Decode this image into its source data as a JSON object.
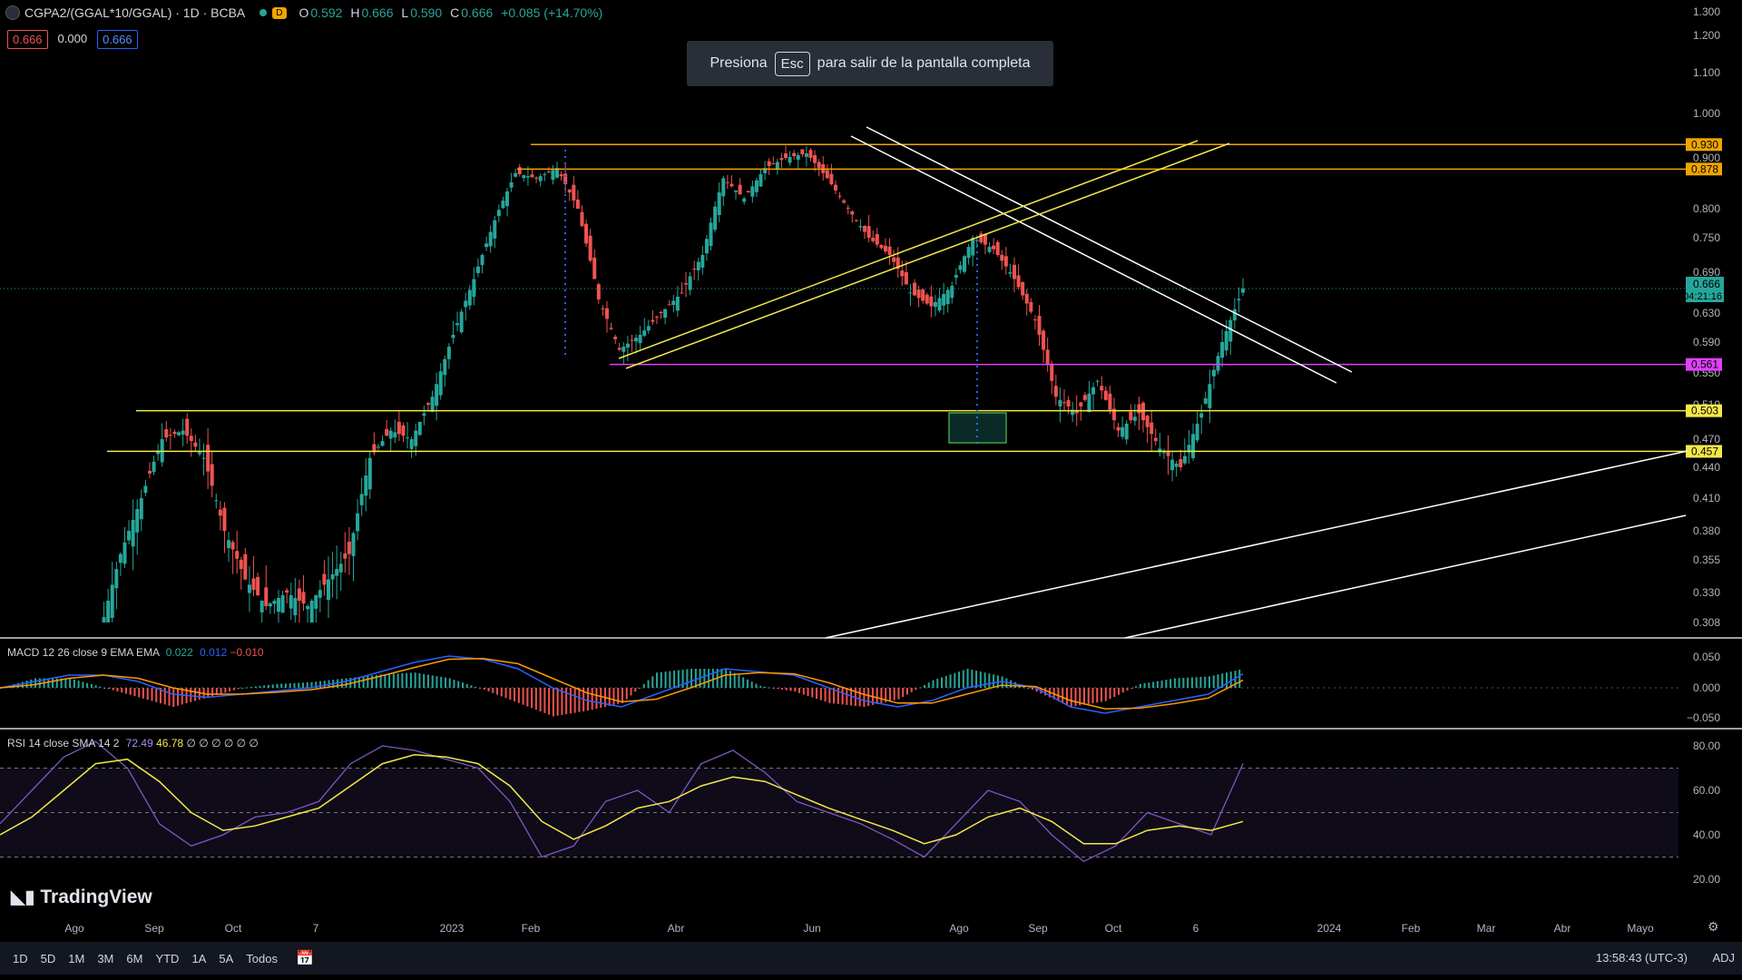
{
  "header": {
    "symbol": "CGPA2/(GGAL*10/GGAL) · 1D · BCBA",
    "d_badge": "D",
    "o_label": "O",
    "o": "0.592",
    "h_label": "H",
    "h": "0.666",
    "l_label": "L",
    "l": "0.590",
    "c_label": "C",
    "c": "0.666",
    "change": "+0.085 (+14.70%)"
  },
  "badges": [
    "0.666",
    "0.000",
    "0.666"
  ],
  "toast": {
    "before": "Presiona",
    "key": "Esc",
    "after": "para salir de la pantalla completa"
  },
  "macd_label": {
    "name": "MACD 12 26 close 9 EMA EMA",
    "v1": "0.022",
    "v2": "0.012",
    "v3": "−0.010"
  },
  "rsi_label": {
    "name": "RSI 14 close SMA 14 2",
    "v1": "72.49",
    "v2": "46.78",
    "rest": "∅ ∅ ∅ ∅ ∅ ∅"
  },
  "logo": "TradingView",
  "timeframes": [
    "1D",
    "5D",
    "1M",
    "3M",
    "6M",
    "YTD",
    "1A",
    "5A",
    "Todos"
  ],
  "clock": "13:58:43 (UTC-3)",
  "adj": "ADJ",
  "colors": {
    "up": "#26a69a",
    "down": "#ef5350",
    "orange": "#f0a500",
    "yellow": "#f5e84a",
    "magenta": "#e040fb",
    "macd": "#2962ff",
    "signal": "#ff9800",
    "rsi": "#7e57c2"
  },
  "chart_data": [
    {
      "type": "candlestick",
      "title": "CGPA2/(GGAL*10/GGAL) · 1D · BCBA",
      "x_ticks": [
        "Ago",
        "Sep",
        "Oct",
        "7",
        "2023",
        "Feb",
        "Abr",
        "Jun",
        "Ago",
        "Sep",
        "Oct",
        "6",
        "2024",
        "Feb",
        "Mar",
        "Abr",
        "Mayo"
      ],
      "y_ticks": [
        "1.300",
        "1.200",
        "1.100",
        "1.000",
        "0.900",
        "0.800",
        "0.750",
        "0.690",
        "0.630",
        "0.590",
        "0.550",
        "0.510",
        "0.470",
        "0.440",
        "0.410",
        "0.380",
        "0.355",
        "0.330",
        "0.308"
      ],
      "closes_approx": [
        0.3,
        0.36,
        0.41,
        0.47,
        0.48,
        0.45,
        0.38,
        0.34,
        0.32,
        0.33,
        0.32,
        0.34,
        0.36,
        0.45,
        0.48,
        0.47,
        0.52,
        0.6,
        0.68,
        0.78,
        0.87,
        0.86,
        0.88,
        0.8,
        0.65,
        0.58,
        0.6,
        0.63,
        0.66,
        0.72,
        0.86,
        0.82,
        0.88,
        0.9,
        0.91,
        0.86,
        0.8,
        0.75,
        0.72,
        0.66,
        0.64,
        0.67,
        0.75,
        0.73,
        0.68,
        0.62,
        0.52,
        0.5,
        0.54,
        0.48,
        0.5,
        0.46,
        0.44,
        0.5,
        0.59,
        0.666
      ],
      "last_price": "0.666",
      "countdown": "04:21:16",
      "horizontal_levels": [
        {
          "value": 0.93,
          "label": "0.930",
          "color": "#f0a500"
        },
        {
          "value": 0.878,
          "label": "0.878",
          "color": "#f0a500"
        },
        {
          "value": 0.561,
          "label": "0.561",
          "color": "#e040fb"
        },
        {
          "value": 0.503,
          "label": "0.503",
          "color": "#f5e84a"
        },
        {
          "value": 0.457,
          "label": "0.457",
          "color": "#f5e84a"
        }
      ]
    },
    {
      "type": "line",
      "title": "MACD 12 26 close 9 EMA EMA",
      "y_ticks": [
        "0.050",
        "0.000",
        "−0.050"
      ],
      "macd_approx": [
        0.0,
        0.01,
        0.02,
        0.02,
        0.01,
        -0.01,
        -0.015,
        -0.01,
        -0.005,
        0.0,
        0.01,
        0.025,
        0.04,
        0.05,
        0.045,
        0.03,
        0.0,
        -0.02,
        -0.03,
        -0.01,
        0.01,
        0.03,
        0.025,
        0.02,
        0.0,
        -0.02,
        -0.03,
        -0.02,
        0.0,
        0.01,
        0.0,
        -0.03,
        -0.04,
        -0.03,
        -0.02,
        -0.01,
        0.022
      ],
      "signal_approx": [
        0.0,
        0.005,
        0.015,
        0.02,
        0.015,
        0.0,
        -0.01,
        -0.01,
        -0.007,
        -0.003,
        0.005,
        0.018,
        0.032,
        0.045,
        0.046,
        0.038,
        0.015,
        -0.008,
        -0.022,
        -0.018,
        0.0,
        0.02,
        0.024,
        0.022,
        0.008,
        -0.01,
        -0.024,
        -0.024,
        -0.01,
        0.004,
        0.002,
        -0.02,
        -0.033,
        -0.032,
        -0.025,
        -0.016,
        0.012
      ]
    },
    {
      "type": "line",
      "title": "RSI 14 close SMA 14 2",
      "y_ticks": [
        "80.00",
        "60.00",
        "40.00",
        "20.00"
      ],
      "bands": [
        70,
        50,
        30
      ],
      "rsi_approx": [
        45,
        60,
        75,
        82,
        70,
        45,
        35,
        40,
        48,
        50,
        55,
        72,
        80,
        78,
        74,
        70,
        55,
        30,
        35,
        55,
        60,
        50,
        72,
        78,
        68,
        55,
        50,
        45,
        38,
        30,
        45,
        60,
        55,
        40,
        28,
        35,
        50,
        45,
        40,
        72
      ],
      "sma_approx": [
        40,
        48,
        60,
        72,
        74,
        64,
        50,
        42,
        44,
        48,
        52,
        62,
        72,
        76,
        75,
        72,
        62,
        46,
        38,
        44,
        52,
        55,
        62,
        66,
        64,
        58,
        52,
        47,
        42,
        36,
        40,
        48,
        52,
        46,
        36,
        36,
        42,
        44,
        42,
        46
      ]
    }
  ]
}
